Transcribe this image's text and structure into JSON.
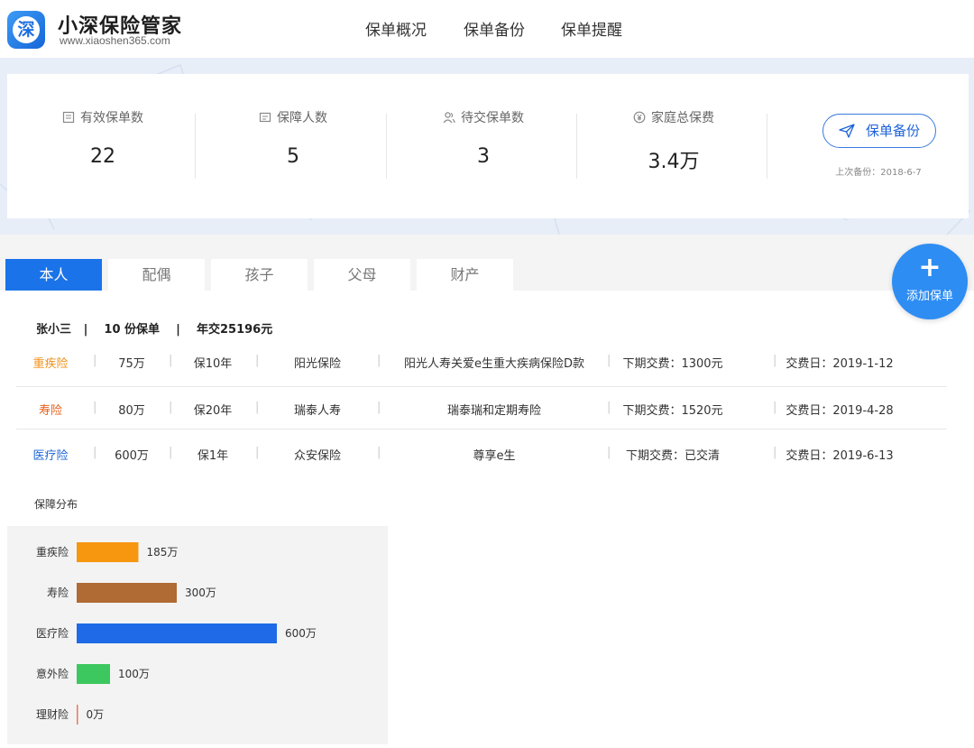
{
  "brand": {
    "logo_char": "深",
    "title": "小深保险管家",
    "url": "www.xiaoshen365.com"
  },
  "nav": [
    "保单概况",
    "保单备份",
    "保单提醒"
  ],
  "stats": [
    {
      "label": "有效保单数",
      "value": "22",
      "icon": "document-icon"
    },
    {
      "label": "保障人数",
      "value": "5",
      "icon": "id-card-icon"
    },
    {
      "label": "待交保单数",
      "value": "3",
      "icon": "users-icon"
    },
    {
      "label": "家庭总保费",
      "value": "3.4万",
      "icon": "yen-icon"
    }
  ],
  "backup": {
    "button_label": "保单备份",
    "last_backup": "上次备份：2018-6-7"
  },
  "tabs": [
    "本人",
    "配偶",
    "孩子",
    "父母",
    "财产"
  ],
  "active_tab": 0,
  "fab": {
    "symbol": "+",
    "label": "添加保单"
  },
  "summary": "张小三   |    10 份保单    |    年交25196元",
  "policies": [
    {
      "type": "重疾险",
      "type_color": "#f0921d",
      "amount": "75万",
      "term": "保10年",
      "company": "阳光保险",
      "product": "阳光人寿关爱e生重大疾病保险D款",
      "next_payment": "下期交费：1300元",
      "pay_date": "交费日：2019-1-12"
    },
    {
      "type": "寿险",
      "type_color": "#e8621d",
      "amount": "80万",
      "term": "保20年",
      "company": "瑞泰人寿",
      "product": "瑞泰瑞和定期寿险",
      "next_payment": "下期交费：1520元",
      "pay_date": "交费日：2019-4-28"
    },
    {
      "type": "医疗险",
      "type_color": "#1e66d6",
      "amount": "600万",
      "term": "保1年",
      "company": "众安保险",
      "product": "尊享e生",
      "next_payment": "下期交费：已交清",
      "pay_date": "交费日：2019-6-13"
    }
  ],
  "chart_data": {
    "type": "bar",
    "orientation": "horizontal",
    "title": "保障分布",
    "categories": [
      "重疾险",
      "寿险",
      "医疗险",
      "意外险",
      "理财险"
    ],
    "values": [
      185,
      300,
      600,
      100,
      0
    ],
    "value_labels": [
      "185万",
      "300万",
      "600万",
      "100万",
      "0万"
    ],
    "colors": [
      "#f7960f",
      "#b06a33",
      "#1f6ae6",
      "#3dc85f",
      "#e47a5c"
    ],
    "xlim": [
      0,
      600
    ],
    "grid": false
  }
}
